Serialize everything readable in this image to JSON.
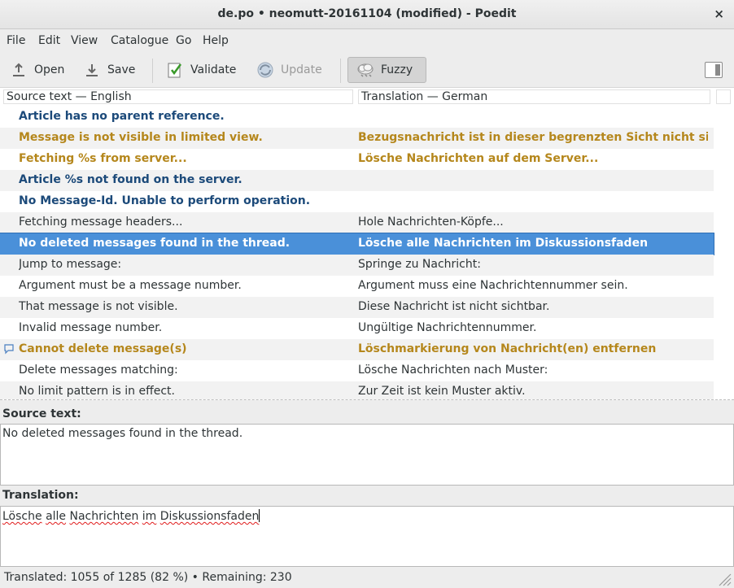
{
  "window": {
    "title": "de.po • neomutt-20161104 (modified) - Poedit",
    "close_label": "×"
  },
  "menu": [
    "File",
    "Edit",
    "View",
    "Catalogue",
    "Go",
    "Help"
  ],
  "toolbar": {
    "open_label": "Open",
    "save_label": "Save",
    "validate_label": "Validate",
    "update_label": "Update",
    "fuzzy_label": "Fuzzy"
  },
  "list": {
    "source_header": "Source text — English",
    "translation_header": "Translation — German",
    "rows": [
      {
        "source": "Article has no parent reference.",
        "translation": "",
        "status": "untranslated",
        "comment": false
      },
      {
        "source": "Message is not visible in limited view.",
        "translation": "Bezugsnachricht ist in dieser begrenzten Sicht nicht sichtbar.",
        "status": "fuzzy",
        "comment": false
      },
      {
        "source": "Fetching %s from server...",
        "translation": "Lösche Nachrichten auf dem Server...",
        "status": "fuzzy",
        "comment": false
      },
      {
        "source": "Article %s not found on the server.",
        "translation": "",
        "status": "untranslated",
        "comment": false
      },
      {
        "source": "No Message-Id. Unable to perform operation.",
        "translation": "",
        "status": "untranslated",
        "comment": false
      },
      {
        "source": "Fetching message headers...",
        "translation": "Hole Nachrichten-Köpfe...",
        "status": "translated",
        "comment": false
      },
      {
        "source": "No deleted messages found in the thread.",
        "translation": "Lösche alle Nachrichten im Diskussionsfaden",
        "status": "selected",
        "comment": false
      },
      {
        "source": "Jump to message: ",
        "translation": "Springe zu Nachricht: ",
        "status": "translated",
        "comment": false
      },
      {
        "source": "Argument must be a message number.",
        "translation": "Argument muss eine Nachrichtennummer sein.",
        "status": "translated",
        "comment": false
      },
      {
        "source": "That message is not visible.",
        "translation": "Diese Nachricht ist nicht sichtbar.",
        "status": "translated",
        "comment": false
      },
      {
        "source": "Invalid message number.",
        "translation": "Ungültige Nachrichtennummer.",
        "status": "translated",
        "comment": false
      },
      {
        "source": "Cannot delete message(s)",
        "translation": "Löschmarkierung von Nachricht(en) entfernen",
        "status": "fuzzy",
        "comment": true
      },
      {
        "source": "Delete messages matching: ",
        "translation": "Lösche Nachrichten nach Muster: ",
        "status": "translated",
        "comment": false
      },
      {
        "source": "No limit pattern is in effect.",
        "translation": "Zur Zeit ist kein Muster aktiv.",
        "status": "translated",
        "comment": false
      }
    ]
  },
  "editor": {
    "source_label": "Source text:",
    "source_text": "No deleted messages found in the thread.",
    "translation_label": "Translation:",
    "translation_words": [
      "Lösche",
      "alle",
      "Nachrichten",
      "im",
      "Diskussionsfaden"
    ]
  },
  "status": {
    "text": "Translated: 1055 of 1285 (82 %)  •  Remaining: 230"
  },
  "colors": {
    "untranslated": "#1c4a7a",
    "fuzzy": "#b5871c",
    "selection": "#4a90d9"
  },
  "icons": [
    "open-icon",
    "save-icon",
    "validate-icon",
    "update-icon",
    "fuzzy-icon",
    "sidebar-toggle-icon",
    "comment-icon",
    "resize-grip-icon"
  ]
}
